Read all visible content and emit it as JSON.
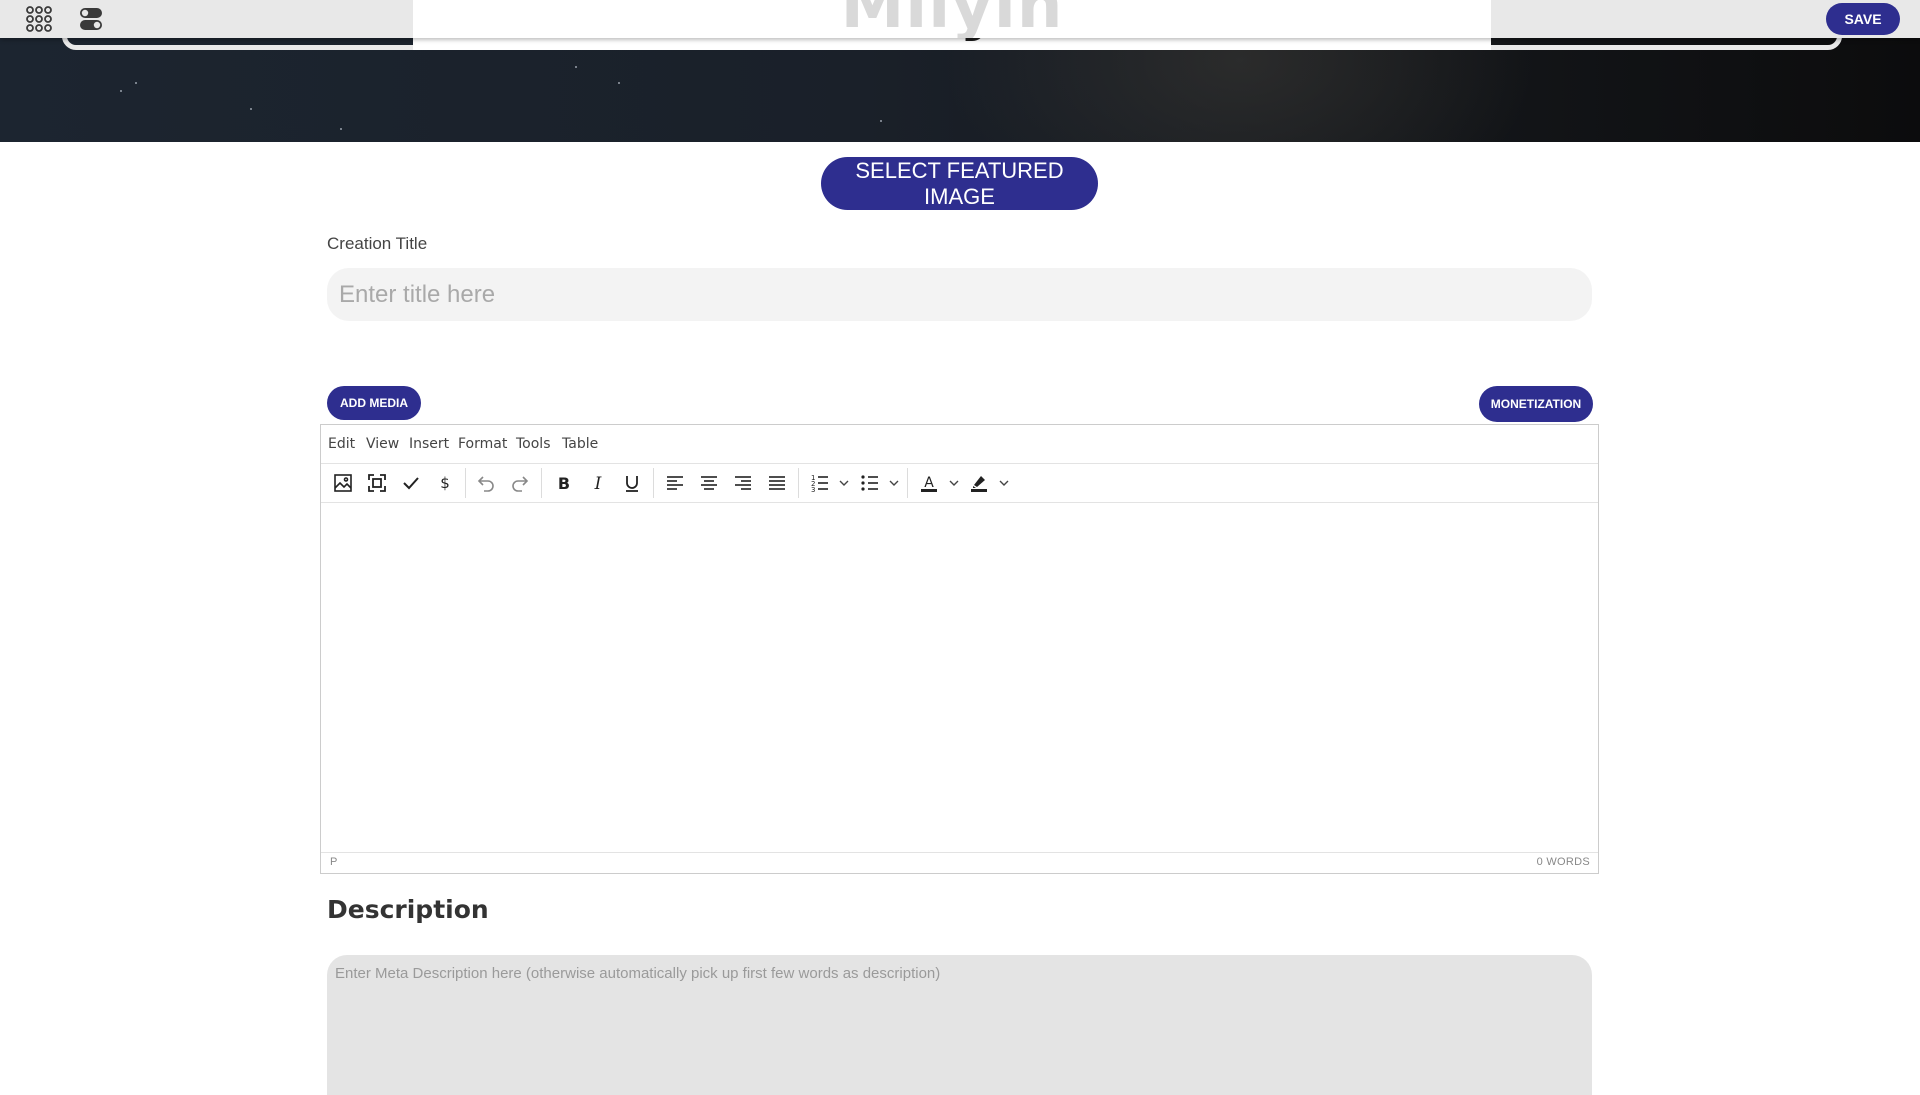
{
  "colors": {
    "accent": "#2e2e8f",
    "topbar_bg": "#e8e8e8",
    "input_bg": "#f3f3f3",
    "description_bg": "#e4e4e4"
  },
  "topbar": {
    "apps_icon": "grid-apps-icon",
    "toggle_icon": "toggle-switches-icon",
    "save_label": "SAVE"
  },
  "hero": {
    "brand_text": "Milyin"
  },
  "form": {
    "featured_image_label": "SELECT FEATURED IMAGE",
    "title_label": "Creation Title",
    "title_placeholder": "Enter title here",
    "title_value": "",
    "add_media_label": "ADD MEDIA",
    "monetization_label": "MONETIZATION"
  },
  "editor": {
    "menu": [
      "Edit",
      "View",
      "Insert",
      "Format",
      "Tools",
      "Table"
    ],
    "toolbar_icons": [
      "image-icon",
      "fullscreen-icon",
      "spellcheck-icon",
      "dollar-icon",
      "undo-icon",
      "redo-icon",
      "bold-icon",
      "italic-icon",
      "underline-icon",
      "align-left-icon",
      "align-center-icon",
      "align-right-icon",
      "align-justify-icon",
      "numbered-list-icon",
      "bullet-list-icon",
      "text-color-icon",
      "highlight-color-icon"
    ],
    "status_path": "P",
    "word_count": "0 WORDS"
  },
  "description": {
    "heading": "Description",
    "placeholder": "Enter Meta Description here (otherwise automatically pick up first few words as description)",
    "value": ""
  }
}
